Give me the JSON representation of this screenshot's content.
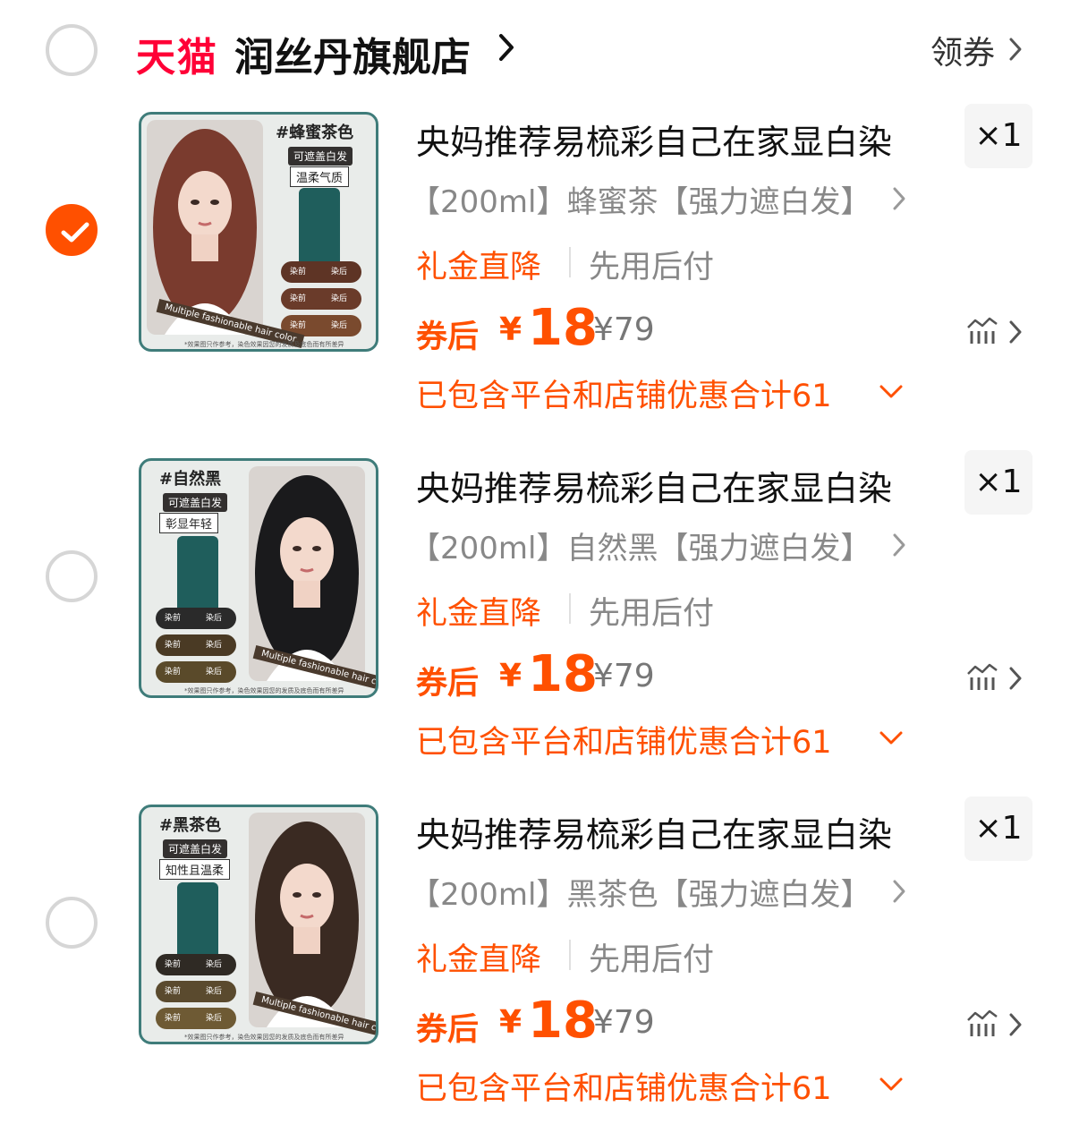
{
  "header": {
    "brand": "天猫",
    "shop_name": "润丝丹旗舰店",
    "coupon_label": "领券"
  },
  "items": [
    {
      "selected": true,
      "title": "央妈推荐易梳彩自己在家显白染",
      "quantity": "×1",
      "sku": "【200ml】蜂蜜茶【强力遮白发】",
      "promo_tag": "礼金直降",
      "pay_tag": "先用后付",
      "price_label": "券后",
      "currency": "¥",
      "price": "18",
      "original_price": "¥79",
      "discount_note": "已包含平台和店铺优惠合计61",
      "thumb": {
        "color_tag": "#蜂蜜茶色",
        "tag_line1": "可遮盖白发",
        "tag_line2": "温柔气质",
        "before": "染前",
        "after": "染后",
        "ribbon": "Multiple fashionable hair color",
        "fine_print": "*效果图只作参考，染色效果因您的发质及底色而有所差异",
        "hair_color": "#7a3b2e"
      }
    },
    {
      "selected": false,
      "title": "央妈推荐易梳彩自己在家显白染",
      "quantity": "×1",
      "sku": "【200ml】自然黑【强力遮白发】",
      "promo_tag": "礼金直降",
      "pay_tag": "先用后付",
      "price_label": "券后",
      "currency": "¥",
      "price": "18",
      "original_price": "¥79",
      "discount_note": "已包含平台和店铺优惠合计61",
      "thumb": {
        "color_tag": "#自然黑",
        "tag_line1": "可遮盖白发",
        "tag_line2": "彰显年轻",
        "before": "染前",
        "after": "染后",
        "ribbon": "Multiple fashionable hair color",
        "fine_print": "*效果图只作参考，染色效果因您的发质及底色而有所差异",
        "hair_color": "#1a1a1c"
      }
    },
    {
      "selected": false,
      "title": "央妈推荐易梳彩自己在家显白染",
      "quantity": "×1",
      "sku": "【200ml】黑茶色【强力遮白发】",
      "promo_tag": "礼金直降",
      "pay_tag": "先用后付",
      "price_label": "券后",
      "currency": "¥",
      "price": "18",
      "original_price": "¥79",
      "discount_note": "已包含平台和店铺优惠合计61",
      "thumb": {
        "color_tag": "#黑茶色",
        "tag_line1": "可遮盖白发",
        "tag_line2": "知性且温柔",
        "before": "染前",
        "after": "染后",
        "ribbon": "Multiple fashionable hair color",
        "fine_print": "*效果图只作参考，染色效果因您的发质及底色而有所差异",
        "hair_color": "#3a2a22"
      }
    }
  ],
  "colors": {
    "accent": "#ff5000",
    "tmall_red": "#ff0036",
    "muted": "#888888",
    "thumb_border": "#3f7c7a"
  }
}
